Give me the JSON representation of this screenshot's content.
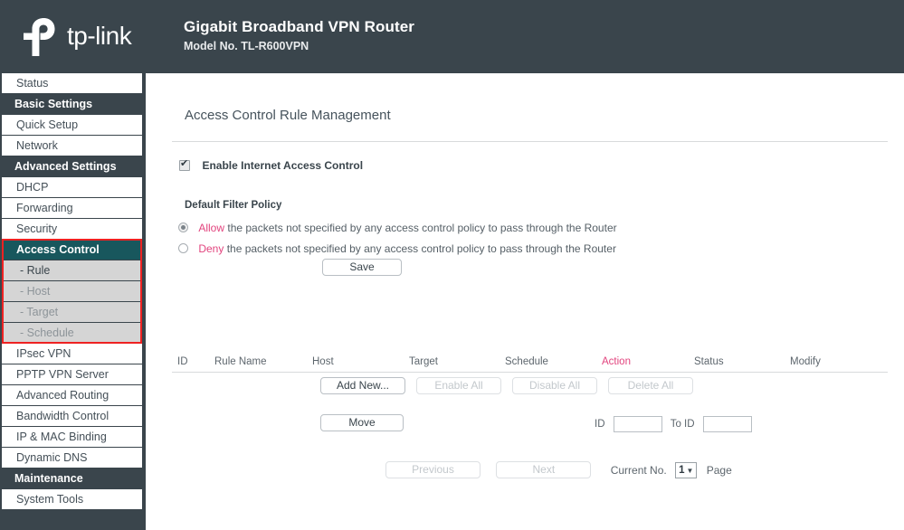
{
  "header": {
    "logo_text": "tp-link",
    "logo_icon": "tplink-logo-icon",
    "product_title": "Gigabit Broadband VPN Router",
    "model_label": "Model No. TL-R600VPN"
  },
  "sidebar": {
    "items": [
      {
        "label": "Status",
        "type": "item"
      },
      {
        "label": "Basic Settings",
        "type": "section"
      },
      {
        "label": "Quick Setup",
        "type": "item"
      },
      {
        "label": "Network",
        "type": "item"
      },
      {
        "label": "Advanced Settings",
        "type": "section"
      },
      {
        "label": "DHCP",
        "type": "item"
      },
      {
        "label": "Forwarding",
        "type": "item"
      },
      {
        "label": "Security",
        "type": "item"
      },
      {
        "label": "Access Control",
        "type": "item",
        "active": true
      },
      {
        "label": "- Rule",
        "type": "sub",
        "dim": false
      },
      {
        "label": "- Host",
        "type": "sub",
        "dim": true
      },
      {
        "label": "- Target",
        "type": "sub",
        "dim": true
      },
      {
        "label": "- Schedule",
        "type": "sub",
        "dim": true
      },
      {
        "label": "IPsec VPN",
        "type": "item"
      },
      {
        "label": "PPTP VPN Server",
        "type": "item"
      },
      {
        "label": "Advanced Routing",
        "type": "item"
      },
      {
        "label": "Bandwidth Control",
        "type": "item"
      },
      {
        "label": "IP & MAC Binding",
        "type": "item"
      },
      {
        "label": "Dynamic DNS",
        "type": "item"
      },
      {
        "label": "Maintenance",
        "type": "section"
      },
      {
        "label": "System Tools",
        "type": "item"
      }
    ]
  },
  "main": {
    "page_title": "Access Control Rule Management",
    "enable_checkbox_label": "Enable Internet Access Control",
    "enable_checkbox_checked": true,
    "policy_heading": "Default Filter Policy",
    "policy_options": [
      {
        "accent_word": "Allow",
        "rest": " the packets not specified by any access control policy to pass through the Router",
        "selected": true
      },
      {
        "accent_word": "Deny",
        "rest": " the packets not specified by any access control policy to pass through the Router",
        "selected": false
      }
    ],
    "save_label": "Save",
    "table_headers": [
      "ID",
      "Rule Name",
      "Host",
      "Target",
      "Schedule",
      "Action",
      "Status",
      "Modify"
    ],
    "table_rows": [],
    "action_buttons": [
      {
        "label": "Add New...",
        "disabled": false
      },
      {
        "label": "Enable All",
        "disabled": true
      },
      {
        "label": "Disable All",
        "disabled": true
      },
      {
        "label": "Delete All",
        "disabled": true
      }
    ],
    "move_label": "Move",
    "move_id_label": "ID",
    "move_id_value": "",
    "move_toid_label": "To ID",
    "move_toid_value": "",
    "pagination": {
      "previous_label": "Previous",
      "previous_disabled": true,
      "next_label": "Next",
      "next_disabled": true,
      "current_label": "Current No.",
      "current_value": "1",
      "page_suffix": "Page"
    }
  },
  "colors": {
    "header_bg": "#3a454c",
    "active_nav": "#18575d",
    "accent_pink": "#e2447e",
    "highlight_red": "#ee2222",
    "sub_nav_bg": "#d5d5d5"
  }
}
